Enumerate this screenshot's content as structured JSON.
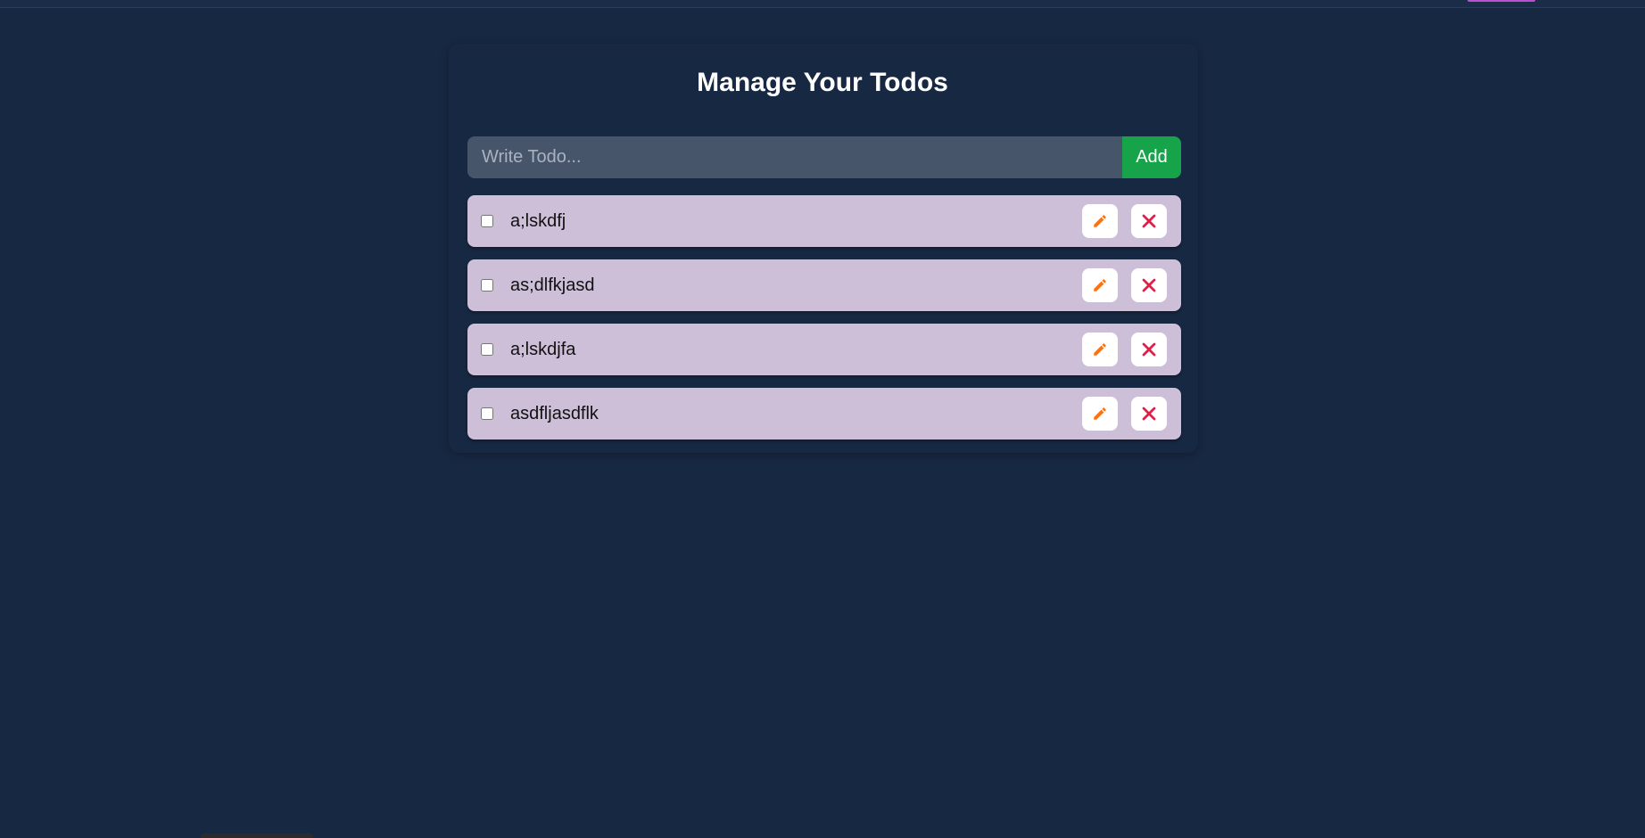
{
  "app": {
    "title": "Manage Your Todos"
  },
  "add_form": {
    "placeholder": "Write Todo...",
    "value": "",
    "add_label": "Add"
  },
  "todos": [
    {
      "text": "a;lskdfj",
      "completed": false
    },
    {
      "text": "as;dlfkjasd",
      "completed": false
    },
    {
      "text": "a;lskdjfa",
      "completed": false
    },
    {
      "text": "asdfljasdflk",
      "completed": false
    }
  ],
  "icons": {
    "edit": "pencil-icon",
    "delete": "close-icon"
  },
  "colors": {
    "background": "#172842",
    "input_bg": "#47556b",
    "add_button": "#16a34a",
    "todo_item_bg": "#cdbfd8",
    "edit_icon": "#f97316",
    "delete_icon": "#e11d48"
  }
}
